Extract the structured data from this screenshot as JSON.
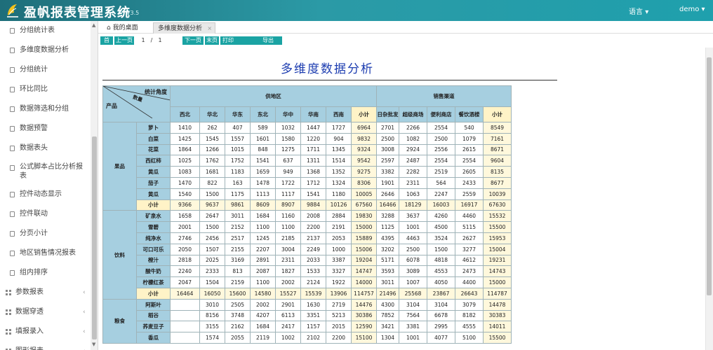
{
  "app": {
    "title": "盈帆报表管理系统",
    "version": "V3.5",
    "lang_menu": "语言",
    "user_menu": "demo"
  },
  "sidebar": {
    "items": [
      {
        "label": "分组统计表",
        "type": "item"
      },
      {
        "label": "多维度数据分析",
        "type": "item"
      },
      {
        "label": "分组统计",
        "type": "item"
      },
      {
        "label": "环比同比",
        "type": "item"
      },
      {
        "label": "数据筛选和分组",
        "type": "item"
      },
      {
        "label": "数据预警",
        "type": "item"
      },
      {
        "label": "数据表头",
        "type": "item"
      },
      {
        "label": "公式脚本占比分析报表",
        "type": "item"
      },
      {
        "label": "控件动态显示",
        "type": "item"
      },
      {
        "label": "控件联动",
        "type": "item"
      },
      {
        "label": "分页小计",
        "type": "item"
      },
      {
        "label": "地区销售情况报表",
        "type": "item"
      },
      {
        "label": "组内排序",
        "type": "item"
      },
      {
        "label": "参数报表",
        "type": "group"
      },
      {
        "label": "数据穿透",
        "type": "group"
      },
      {
        "label": "填报录入",
        "type": "group"
      },
      {
        "label": "图形报表",
        "type": "group"
      }
    ]
  },
  "tabs": {
    "home": "我的桌面",
    "active": "多维度数据分析"
  },
  "pager": {
    "first": "首页",
    "prev": "上一页",
    "page": "1",
    "slash": "/",
    "total": "1",
    "next": "下一页",
    "last": "末页",
    "print": "打印",
    "export": "导出"
  },
  "report": {
    "title": "多维度数据分析",
    "corner": {
      "top": "统计角度",
      "mid": "数量",
      "bottom": "产品"
    },
    "regions": [
      {
        "name": "供地区",
        "colspan": 8
      },
      {
        "name": "销售渠道",
        "colspan": 5
      }
    ],
    "columns": [
      "西北",
      "华北",
      "华东",
      "东北",
      "华中",
      "华南",
      "西南",
      "小计",
      "日杂批发",
      "超级商场",
      "便利商店",
      "餐饮酒楼",
      "小计"
    ],
    "subtotal_cols": [
      7,
      12
    ],
    "categories": [
      {
        "name": "果品",
        "rows": [
          {
            "product": "萝卜",
            "values": [
              "1410",
              "262",
              "407",
              "589",
              "1032",
              "1447",
              "1727",
              "6964",
              "2701",
              "2266",
              "2554",
              "540",
              "8549"
            ]
          },
          {
            "product": "白菜",
            "values": [
              "1425",
              "1545",
              "1557",
              "1601",
              "1580",
              "1220",
              "904",
              "9832",
              "2500",
              "1082",
              "2500",
              "1079",
              "7161"
            ]
          },
          {
            "product": "花菜",
            "values": [
              "1864",
              "1266",
              "1015",
              "848",
              "1275",
              "1711",
              "1345",
              "9324",
              "3008",
              "2924",
              "2556",
              "2615",
              "8671"
            ]
          },
          {
            "product": "西红柿",
            "values": [
              "1025",
              "1762",
              "1752",
              "1541",
              "637",
              "1311",
              "1514",
              "9542",
              "2597",
              "2487",
              "2554",
              "2554",
              "9604"
            ]
          },
          {
            "product": "黄瓜",
            "values": [
              "1083",
              "1681",
              "1183",
              "1659",
              "949",
              "1368",
              "1352",
              "9275",
              "3382",
              "2282",
              "2519",
              "2605",
              "8135"
            ]
          },
          {
            "product": "茄子",
            "values": [
              "1470",
              "822",
              "163",
              "1478",
              "1722",
              "1712",
              "1324",
              "8306",
              "1901",
              "2311",
              "564",
              "2433",
              "8677"
            ]
          },
          {
            "product": "黄瓜",
            "values": [
              "1540",
              "1500",
              "1175",
              "1113",
              "1117",
              "1541",
              "1180",
              "10005",
              "2646",
              "1063",
              "2247",
              "2559",
              "10039"
            ]
          },
          {
            "product": "小计",
            "sub": true,
            "values": [
              "9366",
              "9637",
              "9861",
              "8609",
              "8907",
              "9884",
              "10126",
              "67560",
              "16466",
              "18129",
              "16003",
              "16917",
              "67630"
            ]
          }
        ]
      },
      {
        "name": "饮料",
        "rows": [
          {
            "product": "矿泉水",
            "values": [
              "1658",
              "2647",
              "3011",
              "1684",
              "1160",
              "2008",
              "2884",
              "19830",
              "3288",
              "3637",
              "4260",
              "4460",
              "15532"
            ]
          },
          {
            "product": "雪碧",
            "values": [
              "2001",
              "1500",
              "2152",
              "1100",
              "1100",
              "2200",
              "2191",
              "15000",
              "1125",
              "1001",
              "4500",
              "5115",
              "15500"
            ]
          },
          {
            "product": "纯净水",
            "values": [
              "2746",
              "2456",
              "2517",
              "1245",
              "2185",
              "2137",
              "2053",
              "15889",
              "4395",
              "4463",
              "3524",
              "2627",
              "15953"
            ]
          },
          {
            "product": "可口可乐",
            "values": [
              "2050",
              "1507",
              "2155",
              "2207",
              "3004",
              "2249",
              "1000",
              "15006",
              "3202",
              "2500",
              "1500",
              "3277",
              "15004"
            ]
          },
          {
            "product": "橙汁",
            "values": [
              "2818",
              "2025",
              "3169",
              "2891",
              "2311",
              "2033",
              "3387",
              "19204",
              "5171",
              "6078",
              "4818",
              "4612",
              "19231"
            ]
          },
          {
            "product": "酸牛奶",
            "values": [
              "2240",
              "2333",
              "813",
              "2087",
              "1827",
              "1533",
              "3327",
              "14747",
              "3593",
              "3089",
              "4553",
              "2473",
              "14743"
            ]
          },
          {
            "product": "柠檬红茶",
            "values": [
              "2047",
              "1504",
              "2159",
              "1100",
              "2002",
              "2124",
              "1922",
              "14000",
              "3011",
              "1007",
              "4050",
              "4400",
              "15000"
            ]
          },
          {
            "product": "小计",
            "sub": true,
            "values": [
              "16464",
              "16050",
              "15600",
              "14580",
              "15527",
              "15539",
              "13906",
              "114757",
              "21496",
              "25568",
              "23867",
              "26643",
              "114787"
            ]
          }
        ]
      },
      {
        "name": "粮食",
        "rows": [
          {
            "product": "阿斯叶",
            "values": [
              "",
              "3010",
              "2505",
              "2002",
              "2901",
              "1630",
              "2719",
              "14476",
              "4300",
              "3104",
              "3104",
              "3079",
              "14478"
            ]
          },
          {
            "product": "稻谷",
            "values": [
              "",
              "8156",
              "3748",
              "4207",
              "6113",
              "3351",
              "5213",
              "30386",
              "7852",
              "7564",
              "6678",
              "8182",
              "30383"
            ]
          },
          {
            "product": "荞麦豆子",
            "values": [
              "",
              "3155",
              "2162",
              "1684",
              "2417",
              "1157",
              "2015",
              "12590",
              "3421",
              "3381",
              "2995",
              "4555",
              "14011"
            ]
          },
          {
            "product": "香瓜",
            "values": [
              "",
              "1574",
              "2055",
              "2119",
              "1002",
              "2102",
              "2200",
              "15100",
              "1304",
              "1001",
              "4077",
              "5100",
              "15500"
            ]
          }
        ]
      }
    ]
  }
}
